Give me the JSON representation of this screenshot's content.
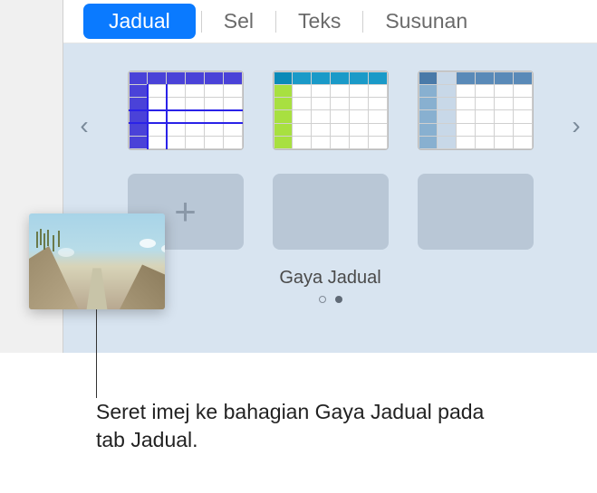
{
  "tabs": {
    "jadual": "Jadual",
    "sel": "Sel",
    "teks": "Teks",
    "susunan": "Susunan"
  },
  "section": {
    "title": "Gaya Jadual"
  },
  "caption": {
    "text": "Seret imej ke bahagian Gaya Jadual pada tab Jadual."
  }
}
